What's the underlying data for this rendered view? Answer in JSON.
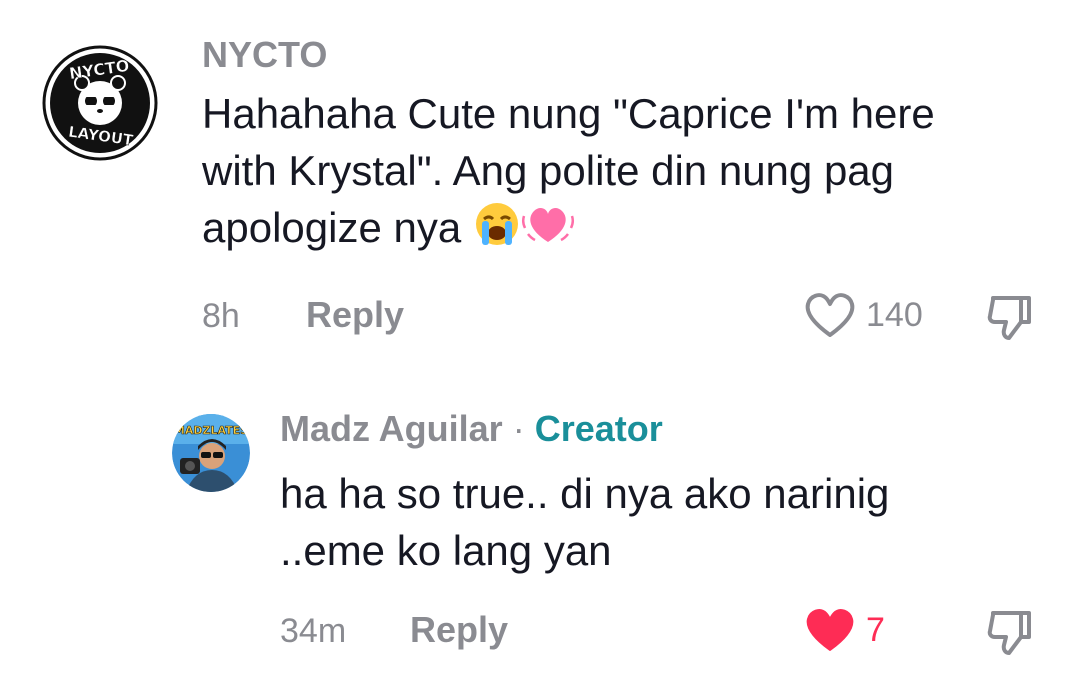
{
  "comments": [
    {
      "username": "NYCTO",
      "avatar": "nycto-layout-logo",
      "avatar_text_top": "NYCTO",
      "avatar_text_bottom": "LAYOUT",
      "text": "Hahahaha Cute nung \"Caprice I'm here with Krystal\". Ang polite din nung pag apologize nya",
      "emojis": [
        "loudly-crying-face",
        "beating-heart"
      ],
      "time": "8h",
      "reply_label": "Reply",
      "like_count": "140",
      "liked": false
    }
  ],
  "replies": [
    {
      "username": "Madz Aguilar",
      "separator": "·",
      "badge": "Creator",
      "avatar": "madz-aguilar-photo",
      "text": "ha ha so true.. di nya ako narinig ..eme ko lang yan",
      "time": "34m",
      "reply_label": "Reply",
      "like_count": "7",
      "liked": true
    }
  ],
  "colors": {
    "text": "#161823",
    "muted": "#8a8b91",
    "creator": "#1a8f9a",
    "liked_heart": "#fe2c55"
  }
}
